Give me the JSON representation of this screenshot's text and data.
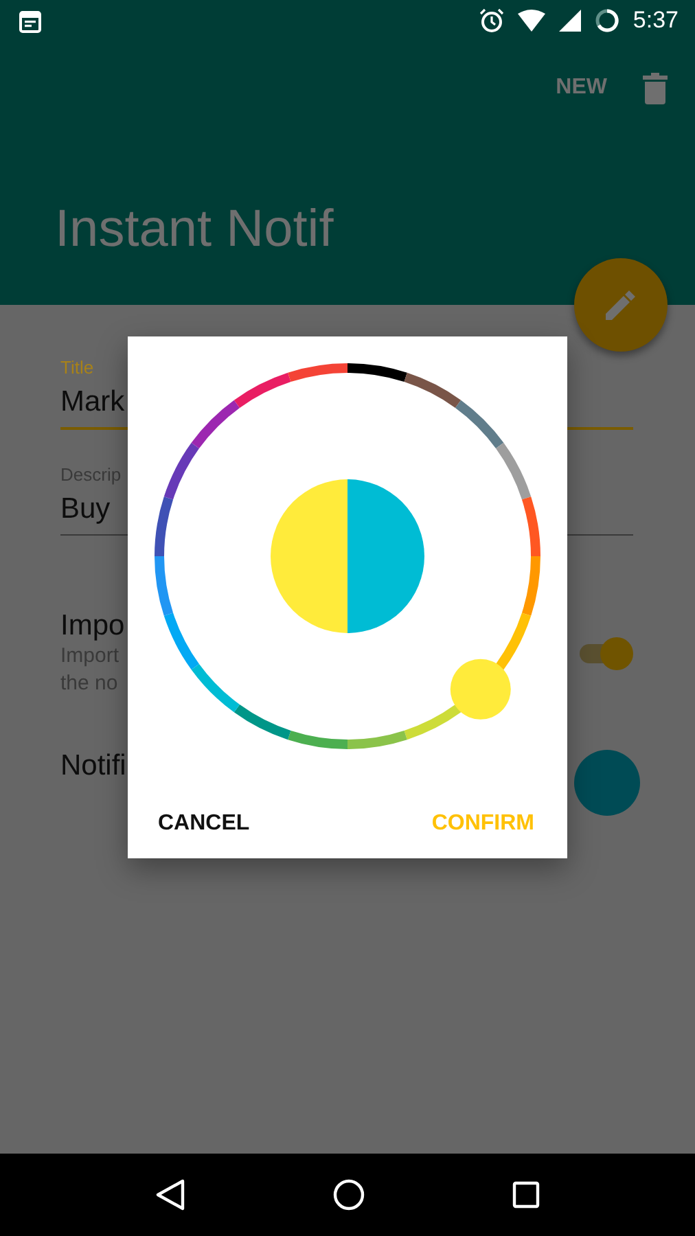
{
  "status_bar": {
    "time": "5:37"
  },
  "app_bar": {
    "actions": [
      {
        "kind": "text",
        "label": "NEW"
      },
      {
        "kind": "delete"
      }
    ],
    "title": "Instant Notif"
  },
  "form": {
    "title_field": {
      "label": "Title",
      "value": "Mark",
      "focused": true
    },
    "description_field": {
      "label": "Descrip",
      "value": "Buy",
      "focused": false
    },
    "important": {
      "label": "Impo",
      "description": [
        "Import",
        "the no"
      ],
      "on": true
    },
    "notification_color": {
      "label": "Notifi",
      "color": "#00bcd4"
    }
  },
  "dialog": {
    "swatches": [
      {
        "color": "#000000",
        "selected": false
      },
      {
        "color": "#795548",
        "selected": false
      },
      {
        "color": "#607d8b",
        "selected": false
      },
      {
        "color": "#9e9e9e",
        "selected": false
      },
      {
        "color": "#ff5722",
        "selected": false
      },
      {
        "color": "#ff9800",
        "selected": false
      },
      {
        "color": "#ffc107",
        "selected": false
      },
      {
        "color": "#ffeb3b",
        "selected": true
      },
      {
        "color": "#cddc39",
        "selected": false
      },
      {
        "color": "#8bc34a",
        "selected": false
      },
      {
        "color": "#4caf50",
        "selected": false
      },
      {
        "color": "#009688",
        "selected": false
      },
      {
        "color": "#00bcd4",
        "selected": false
      },
      {
        "color": "#03a9f4",
        "selected": false
      },
      {
        "color": "#2196f3",
        "selected": false
      },
      {
        "color": "#3f51b5",
        "selected": false
      },
      {
        "color": "#673ab7",
        "selected": false
      },
      {
        "color": "#9c27b0",
        "selected": false
      },
      {
        "color": "#e91e63",
        "selected": false
      },
      {
        "color": "#f44336",
        "selected": false
      }
    ],
    "buttons": [
      {
        "label": "CANCEL",
        "kind": "neutral"
      },
      {
        "label": "CONFIRM",
        "kind": "positive"
      }
    ]
  }
}
